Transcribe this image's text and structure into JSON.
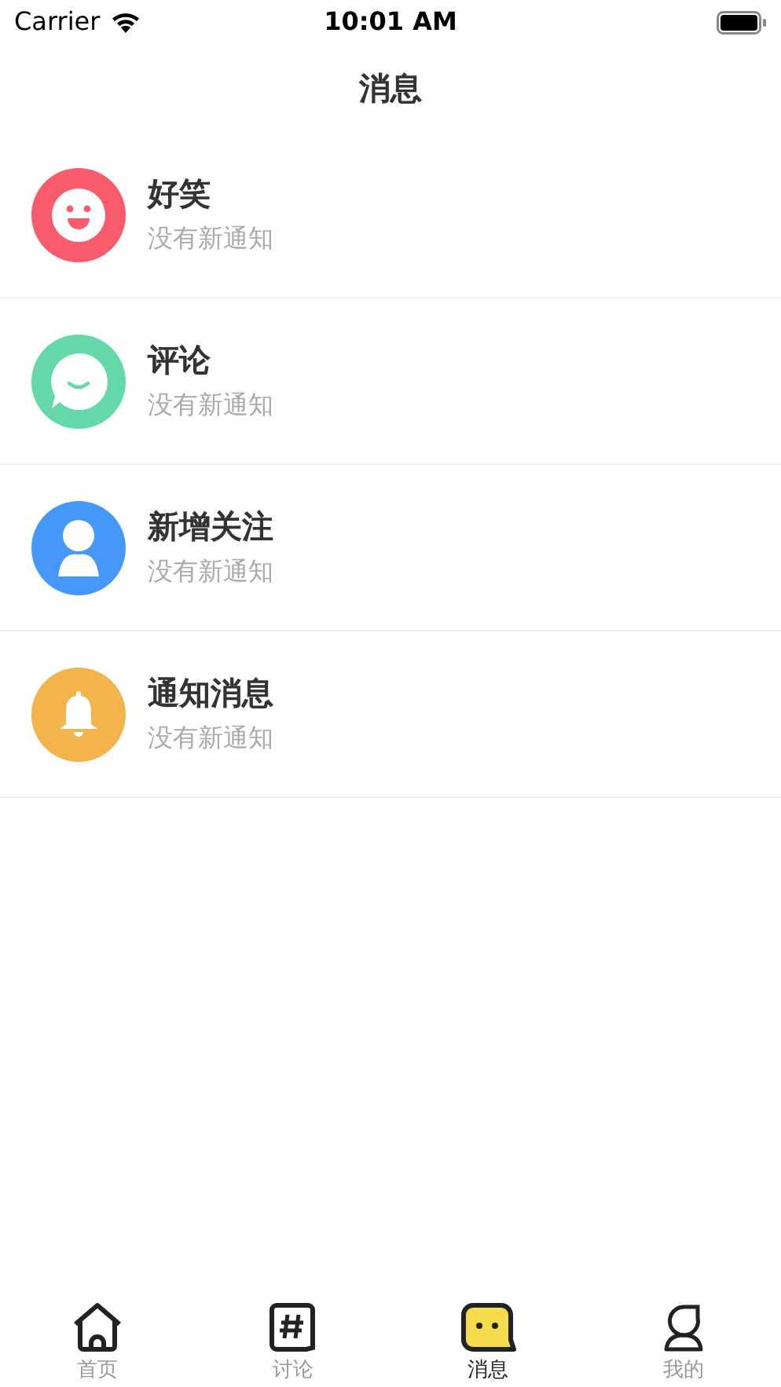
{
  "status_bar": {
    "carrier": "Carrier",
    "time": "10:01 AM"
  },
  "title": "消息",
  "items": [
    {
      "kind": "smile",
      "color": "#f85c6c",
      "title": "好笑",
      "subtitle": "没有新通知"
    },
    {
      "kind": "chat",
      "color": "#64d8a8",
      "title": "评论",
      "subtitle": "没有新通知"
    },
    {
      "kind": "person",
      "color": "#4598f8",
      "title": "新增关注",
      "subtitle": "没有新通知"
    },
    {
      "kind": "bell",
      "color": "#f4b44c",
      "title": "通知消息",
      "subtitle": "没有新通知"
    }
  ],
  "tabs": [
    {
      "kind": "home",
      "label": "首页",
      "selected": false
    },
    {
      "kind": "hash",
      "label": "讨论",
      "selected": false
    },
    {
      "kind": "message",
      "label": "消息",
      "selected": true
    },
    {
      "kind": "me",
      "label": "我的",
      "selected": false
    }
  ]
}
